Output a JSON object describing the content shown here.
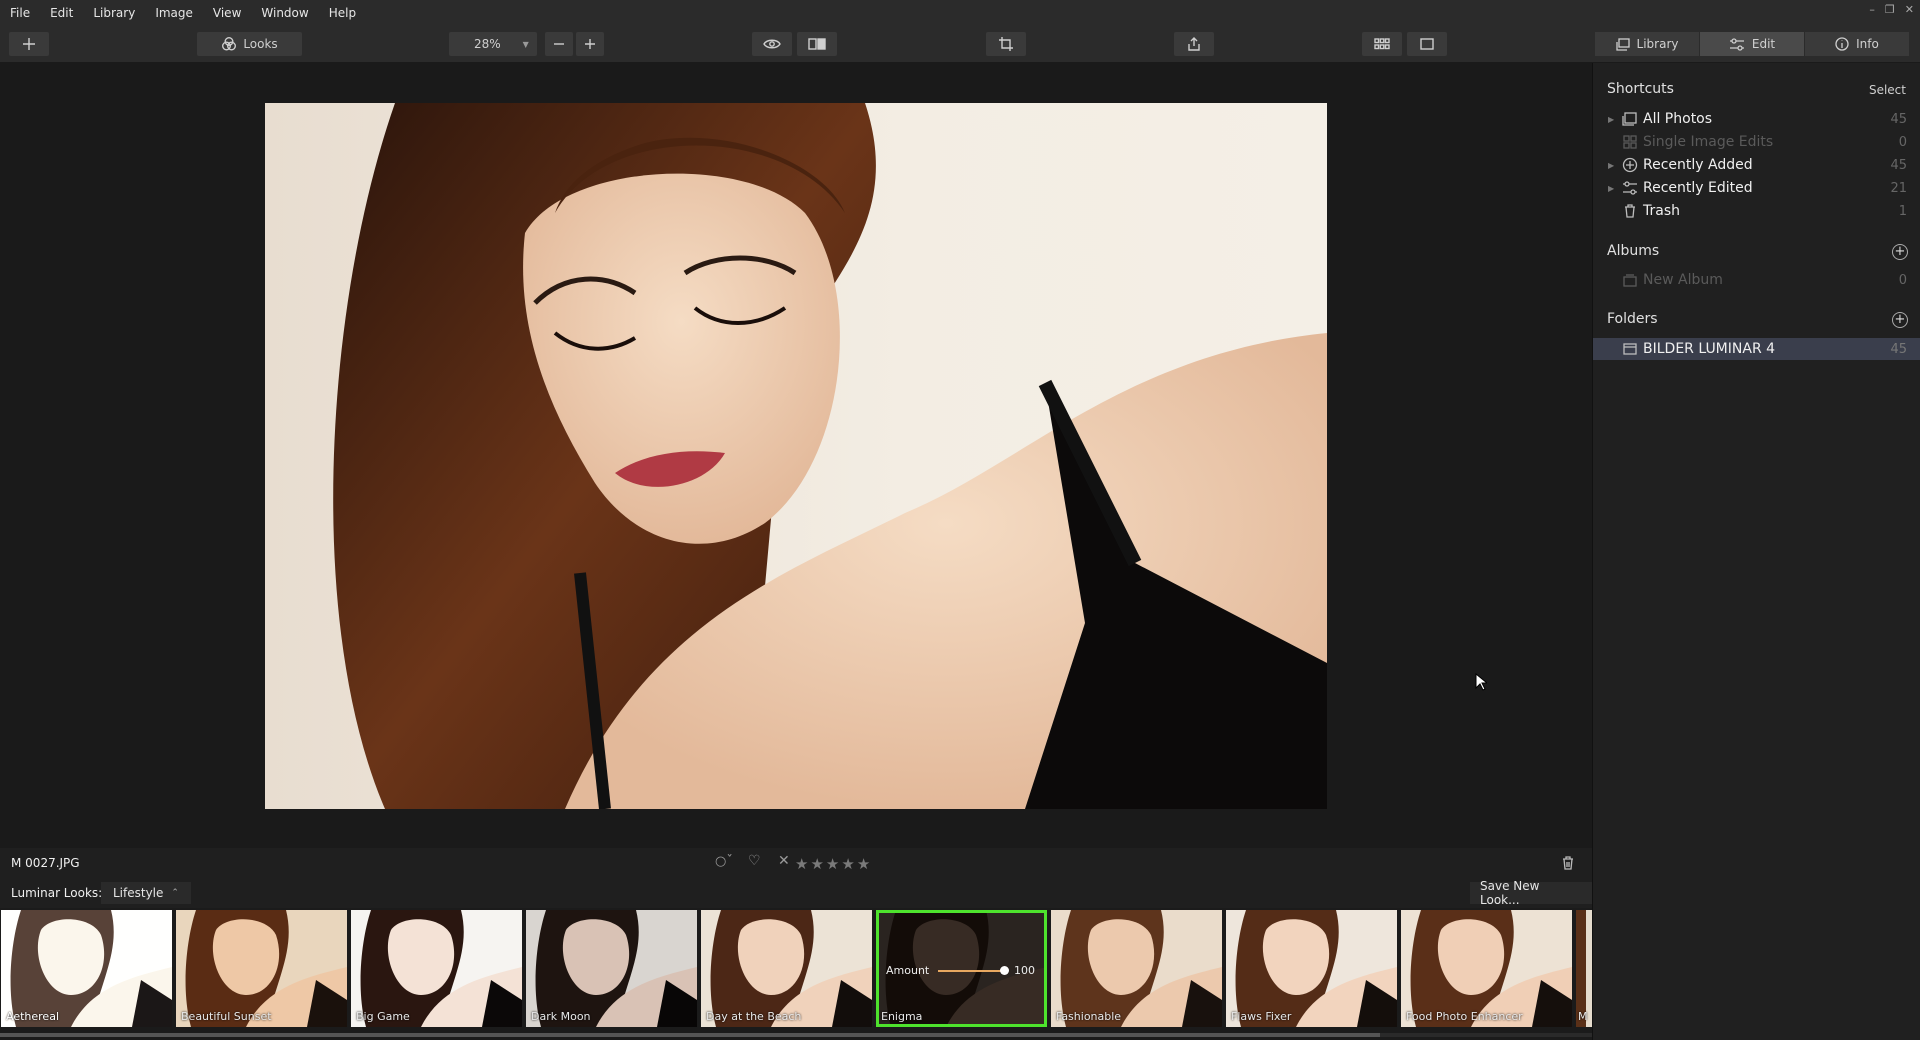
{
  "menu": [
    "File",
    "Edit",
    "Library",
    "Image",
    "View",
    "Window",
    "Help"
  ],
  "toolbar": {
    "looks_label": "Looks",
    "zoom_value": "28%"
  },
  "tabs": {
    "library": "Library",
    "edit": "Edit",
    "info": "Info"
  },
  "sidebar": {
    "shortcuts_title": "Shortcuts",
    "select_label": "Select",
    "shortcuts": [
      {
        "label": "All Photos",
        "count": "45",
        "icon": "photos-icon"
      },
      {
        "label": "Single Image Edits",
        "count": "0",
        "icon": "grid-icon"
      },
      {
        "label": "Recently Added",
        "count": "45",
        "icon": "plus-circle-icon"
      },
      {
        "label": "Recently Edited",
        "count": "21",
        "icon": "sliders-icon"
      },
      {
        "label": "Trash",
        "count": "1",
        "icon": "trash-icon"
      }
    ],
    "albums_title": "Albums",
    "albums": [
      {
        "label": "New Album",
        "count": "0"
      }
    ],
    "folders_title": "Folders",
    "folders": [
      {
        "label": "BILDER LUMINAR 4",
        "count": "45"
      }
    ]
  },
  "infobar": {
    "filename": "M  0027.JPG",
    "rating": 0
  },
  "looks": {
    "prefix": "Luminar Looks:",
    "category": "Lifestyle",
    "save_label": "Save New Look...",
    "amount_label": "Amount",
    "amount_value": "100",
    "items": [
      "Aethereal",
      "Beautiful Sunset",
      "Big Game",
      "Dark Moon",
      "Day at the Beach",
      "Enigma",
      "Fashionable",
      "Flaws Fixer",
      "Food Photo Enhancer",
      "M"
    ]
  }
}
